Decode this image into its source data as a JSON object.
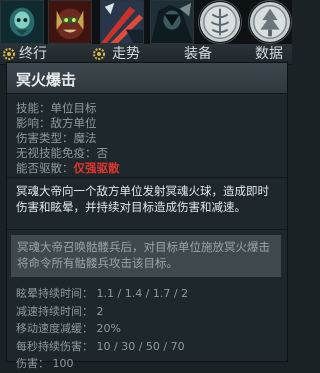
{
  "icons": [
    {
      "name": "wraith-king-portrait-icon"
    },
    {
      "name": "ogre-mask-portrait-icon"
    },
    {
      "name": "red-blades-portrait-icon"
    },
    {
      "name": "dark-hero-portrait-icon"
    },
    {
      "name": "vine-emblem-icon"
    },
    {
      "name": "tree-emblem-icon"
    }
  ],
  "tabs": {
    "t1": "终行",
    "t2": "走势",
    "t3": "装备",
    "t4": "数据"
  },
  "ability": {
    "title": "冥火爆击",
    "props": [
      {
        "label": "技能：",
        "value": "单位目标"
      },
      {
        "label": "影响：",
        "value": "敌方单位"
      },
      {
        "label": "伤害类型：",
        "value": "魔法"
      },
      {
        "label": "无视技能免疫：",
        "value": "否"
      }
    ],
    "dispel_label": "能否驱散：",
    "dispel_value": "仅强驱散",
    "description": "冥魂大帝向一个敌方单位发射冥魂火球，造成即时伤害和眩晕，并持续对目标造成伤害和减速。",
    "lore": "冥魂大帝召唤骷髅兵后，对目标单位施放冥火爆击将命令所有骷髅兵攻击该目标。",
    "stats": [
      {
        "label": "眩晕持续时间：",
        "value": "1.1 / 1.4 / 1.7 / 2"
      },
      {
        "label": "减速持续时间：",
        "value": "2"
      },
      {
        "label": "移动速度减缓：",
        "value": "20%"
      },
      {
        "label": "每秒持续伤害：",
        "value": "10 / 30 / 50 / 70"
      },
      {
        "label": "伤害：",
        "value": "100"
      }
    ]
  },
  "colors": {
    "background": "#1b2226",
    "header": "#3a4449",
    "dispel_red": "#e0352e",
    "lore_bg": "#3e484d"
  }
}
